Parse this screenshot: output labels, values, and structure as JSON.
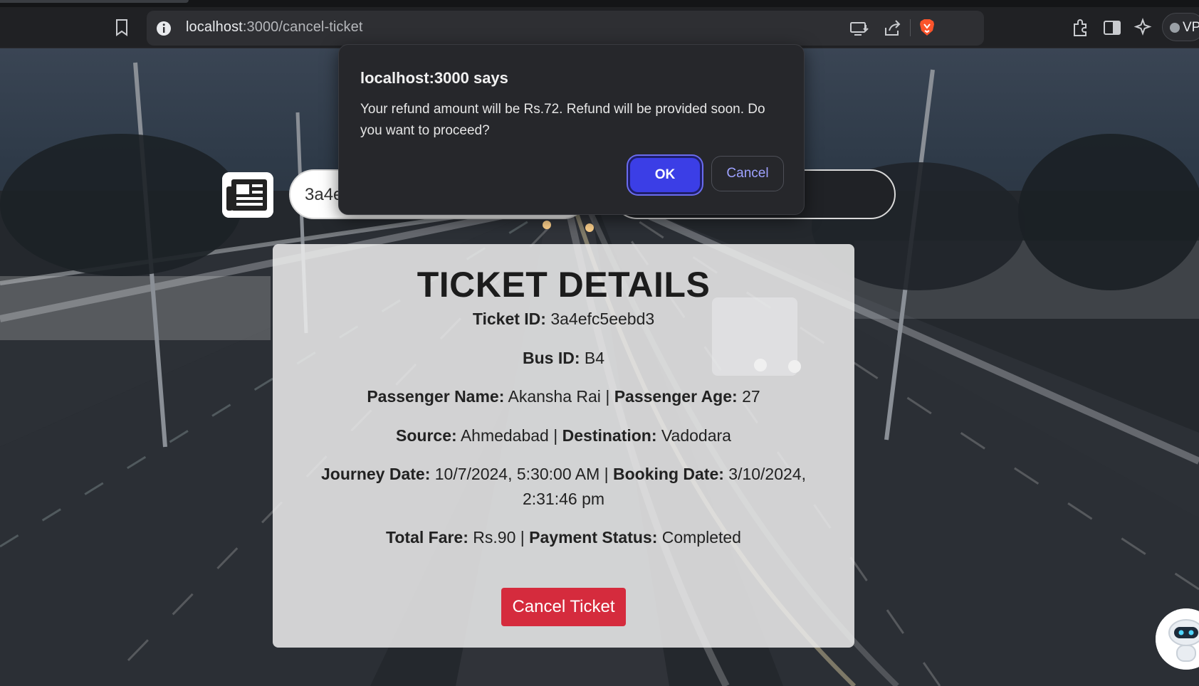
{
  "browser": {
    "url_host": "localhost",
    "url_path": ":3000/cancel-ticket",
    "vpn_label": "VP"
  },
  "page": {
    "search_value": "3a4e",
    "card": {
      "title": "TICKET DETAILS",
      "ticket_id_label": "Ticket ID:",
      "ticket_id": "3a4efc5eebd3",
      "bus_id_label": "Bus ID:",
      "bus_id": "B4",
      "passenger_name_label": "Passenger Name:",
      "passenger_name": "Akansha Rai",
      "passenger_age_label": "Passenger Age:",
      "passenger_age": "27",
      "source_label": "Source:",
      "source": "Ahmedabad",
      "destination_label": "Destination:",
      "destination": "Vadodara",
      "journey_date_label": "Journey Date:",
      "journey_date": "10/7/2024, 5:30:00 AM",
      "booking_date_label": "Booking Date:",
      "booking_date": "3/10/2024,",
      "booking_time": "2:31:46 pm",
      "total_fare_label": "Total Fare:",
      "total_fare": "Rs.90",
      "payment_status_label": "Payment Status:",
      "payment_status": "Completed",
      "separator": "|",
      "cancel_button": "Cancel Ticket"
    }
  },
  "dialog": {
    "title": "localhost:3000 says",
    "message": "Your refund amount will be Rs.72. Refund will be provided soon. Do you want to proceed?",
    "ok_label": "OK",
    "cancel_label": "Cancel"
  },
  "colors": {
    "accent_ok": "#3b3ee6",
    "danger": "#d52b3d"
  }
}
